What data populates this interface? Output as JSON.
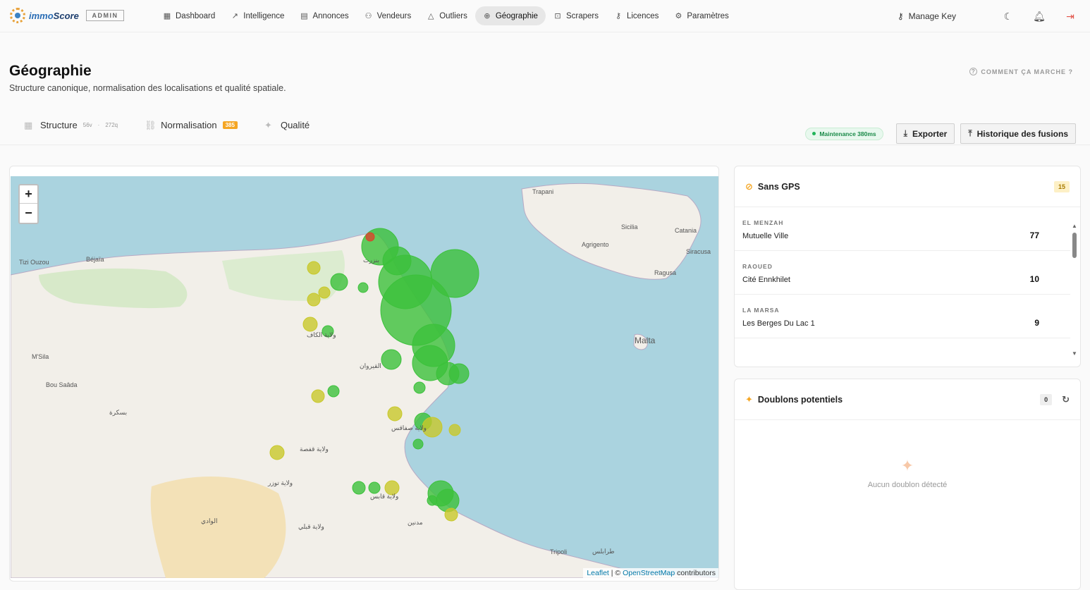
{
  "brand": {
    "name_first": "immo",
    "name_second": "Score",
    "badge": "ADMIN"
  },
  "nav": [
    {
      "label": "Dashboard",
      "icon": "grid-icon"
    },
    {
      "label": "Intelligence",
      "icon": "trend-icon"
    },
    {
      "label": "Annonces",
      "icon": "list-icon"
    },
    {
      "label": "Vendeurs",
      "icon": "users-icon"
    },
    {
      "label": "Outliers",
      "icon": "warning-icon"
    },
    {
      "label": "Géographie",
      "icon": "globe-icon",
      "active": true
    },
    {
      "label": "Scrapers",
      "icon": "bot-icon"
    },
    {
      "label": "Licences",
      "icon": "key-icon"
    },
    {
      "label": "Paramètres",
      "icon": "gear-icon"
    }
  ],
  "toolbar": {
    "manage_key": "Manage Key"
  },
  "page": {
    "title": "Géographie",
    "subtitle": "Structure canonique, normalisation des localisations et qualité spatiale.",
    "help_link": "COMMENT ÇA MARCHE ?"
  },
  "tabs": [
    {
      "label": "Structure",
      "meta_a": "56v",
      "meta_sep": "·",
      "meta_b": "272q"
    },
    {
      "label": "Normalisation",
      "badge": "385"
    },
    {
      "label": "Qualité"
    }
  ],
  "actions": {
    "maintenance": "Maintenance 380ms",
    "export": "Exporter",
    "history": "Historique des fusions"
  },
  "map": {
    "zoom_in": "+",
    "zoom_out": "−",
    "attribution_leaflet": "Leaflet",
    "attribution_sep": " | © ",
    "attribution_osm": "OpenStreetMap",
    "attribution_suffix": " contributors",
    "labels": [
      {
        "text": "Trapani"
      },
      {
        "text": "Sicilia"
      },
      {
        "text": "Catania"
      },
      {
        "text": "Agrigento"
      },
      {
        "text": "Siracusa"
      },
      {
        "text": "Ragusa"
      },
      {
        "text": "Malta"
      },
      {
        "text": "Tizi Ouzou"
      },
      {
        "text": "Béjaïa"
      },
      {
        "text": "M'Sila"
      },
      {
        "text": "Bou Saâda"
      },
      {
        "text": "Tripoli"
      },
      {
        "text": "بنزرت"
      },
      {
        "text": "ولاية الكاف"
      },
      {
        "text": "القيروان"
      },
      {
        "text": "ولاية صفاقس"
      },
      {
        "text": "ولاية قفصة"
      },
      {
        "text": "ولاية توزر"
      },
      {
        "text": "ولاية قابس"
      },
      {
        "text": "مدنين"
      },
      {
        "text": "طرابلس"
      },
      {
        "text": "بسكرة"
      },
      {
        "text": "ولاية قبلي"
      },
      {
        "text": "الوادي"
      }
    ]
  },
  "sans_gps": {
    "title": "Sans GPS",
    "count": "15",
    "rows": [
      {
        "area": "EL MENZAH",
        "location": "Mutuelle Ville",
        "value": "77"
      },
      {
        "area": "RAOUED",
        "location": "Cité Ennkhilet",
        "value": "10"
      },
      {
        "area": "LA MARSA",
        "location": "Les Berges Du Lac 1",
        "value": "9"
      }
    ]
  },
  "doublons": {
    "title": "Doublons potentiels",
    "count": "0",
    "empty_message": "Aucun doublon détecté"
  },
  "colors": {
    "sea": "#aad3df",
    "land": "#f2efe9",
    "marker_green": "#3cc13b",
    "marker_yellow": "#c8c82a",
    "marker_red": "#d9432b"
  }
}
